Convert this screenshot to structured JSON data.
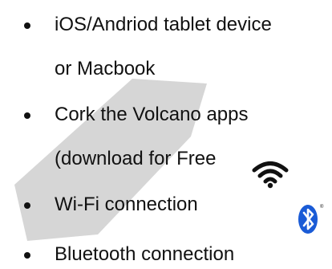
{
  "colors": {
    "text": "#111111",
    "highlight_stroke": "#c8c8c8",
    "wifi": "#111111",
    "bluetooth_bg": "#1a5bd6"
  },
  "icons": [
    "wifi-icon",
    "bluetooth-icon"
  ],
  "list": [
    {
      "lines": [
        "iOS/Andriod tablet device",
        "or Macbook"
      ]
    },
    {
      "lines": [
        "Cork the Volcano apps",
        "(download for Free"
      ]
    },
    {
      "lines": [
        "Wi-Fi connection"
      ]
    },
    {
      "lines": [
        "Bluetooth connection"
      ]
    }
  ],
  "bluetooth_mark": "®"
}
